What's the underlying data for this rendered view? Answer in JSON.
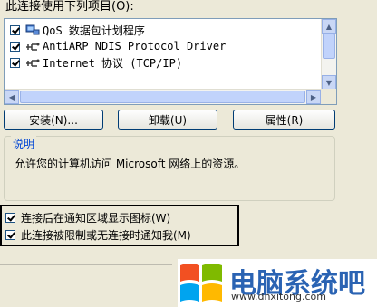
{
  "connection": {
    "uses_label": "此连接使用下列项目(O):",
    "items": [
      {
        "label": "QoS 数据包计划程序",
        "checked": true,
        "icon": "network-service-icon"
      },
      {
        "label": "AntiARP NDIS Protocol Driver",
        "checked": true,
        "icon": "network-protocol-icon"
      },
      {
        "label": "Internet 协议 (TCP/IP)",
        "checked": true,
        "icon": "network-protocol-icon"
      }
    ]
  },
  "buttons": {
    "install": "安装(N)...",
    "uninstall": "卸载(U)",
    "properties": "属性(R)"
  },
  "description": {
    "legend": "说明",
    "text": "允许您的计算机访问 Microsoft 网络上的资源。"
  },
  "options": [
    {
      "label": "连接后在通知区域显示图标(W)",
      "checked": true
    },
    {
      "label": "此连接被限制或无连接时通知我(M)",
      "checked": true
    }
  ],
  "watermark": {
    "name": "电脑系统吧",
    "url": "www.dnxitong.com"
  },
  "colors": {
    "accent": "#0046d5",
    "brand": "#2a63b3"
  }
}
